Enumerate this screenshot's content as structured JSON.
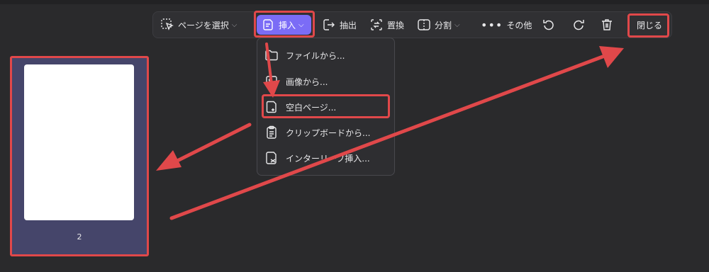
{
  "toolbar": {
    "select_page": "ページを選択",
    "insert": "挿入",
    "extract": "抽出",
    "replace": "置換",
    "split": "分割",
    "more": "その他",
    "close": "閉じる"
  },
  "insert_menu": {
    "items": [
      {
        "label": "ファイルから...",
        "icon": "folder-icon"
      },
      {
        "label": "画像から...",
        "icon": "image-icon"
      },
      {
        "label": "空白ページ...",
        "icon": "blank-page-icon"
      },
      {
        "label": "クリップボードから...",
        "icon": "clipboard-icon"
      },
      {
        "label": "インターリーブ挿入...",
        "icon": "interleave-icon"
      }
    ]
  },
  "pages": [
    {
      "number": "2"
    }
  ],
  "colors": {
    "accent": "#7b6cf6",
    "highlight": "#e0484a",
    "background": "#2a2a2c",
    "thumbnail_selected": "#45456a"
  }
}
